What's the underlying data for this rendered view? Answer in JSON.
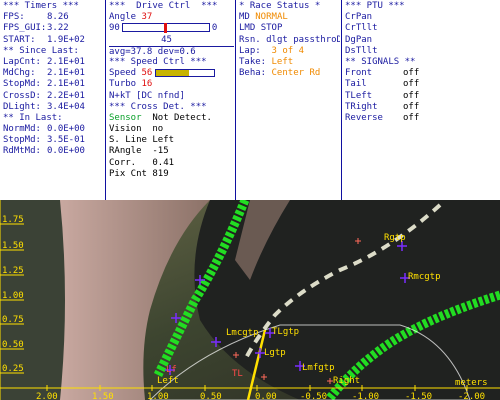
{
  "timers": {
    "header": "*** Timers ***",
    "fps_label": "FPS:",
    "fps": "8.26",
    "fps_gui_label": "FPS_GUI:",
    "fps_gui": "3.22",
    "start_label": "START:",
    "start": "1.9E+02",
    "since_header": "** Since Last:",
    "lapcnt_label": "LapCnt:",
    "lapcnt": "2.1E+01",
    "mdchg_label": "MdChg:",
    "mdchg": "2.1E+01",
    "stopmd_label": "StopMd:",
    "stopmd": "2.1E+01",
    "crossd_label": "CrossD:",
    "crossd": "2.2E+01",
    "dlight_label": "DLight:",
    "dlight": "3.4E+04",
    "inlast_header": "** In Last:",
    "normmd_label": "NormMd:",
    "normmd": "0.0E+00",
    "stopmd2_label": "StopMd:",
    "stopmd2": "3.5E-01",
    "rdmtmd_label": "RdMtMd:",
    "rdmtmd": "0.0E+00"
  },
  "drive": {
    "header": "***  Drive Ctrl  ***",
    "angle_label": "Angle",
    "angle": "37",
    "slider_min": "90",
    "slider_max": "0",
    "slider_value": 45,
    "slider_mid": "45",
    "avg": "avg=37.8",
    "dev": "dev=0.6",
    "speed_header": "*** Speed Ctrl ***",
    "speed_label": "Speed",
    "speed": "56",
    "speed_fraction": 0.56,
    "turbo_label": "Turbo",
    "turbo": "16",
    "nkt": "N+kT [DC nfnd]",
    "cross_header": "*** Cross Det. ***",
    "sensor_label": "Sensor",
    "sensor": "Not Detect.",
    "vision_label": "Vision",
    "vision": "no",
    "sline_label": "S. Line",
    "sline": "Left",
    "rangle_label": "RAngle",
    "rangle": "-15",
    "corr_label": "Corr.",
    "corr": "0.41",
    "pix_label": "Pix Cnt",
    "pix": "819"
  },
  "race": {
    "header": "* Race Status *",
    "md_label": "MD",
    "md": "NORMAL",
    "lmd_label": "LMD",
    "lmd": "STOP",
    "rsn_label": "Rsn.",
    "rsn": "dlgt passthroDgR",
    "lap_label": "Lap:",
    "lap": "3 of 4",
    "take_label": "Take:",
    "take": "Left",
    "beha_label": "Beha:",
    "beha": "Center Rd"
  },
  "ptu": {
    "header": "*** PTU ***",
    "items": [
      "CrPan",
      "CrTllt",
      "DgPan",
      "DsTllt"
    ],
    "signals_header": "** SIGNALS **",
    "signals": [
      {
        "name": "Front",
        "state": "off"
      },
      {
        "name": "Tail",
        "state": "off"
      },
      {
        "name": "TLeft",
        "state": "off"
      },
      {
        "name": "TRight",
        "state": "off"
      },
      {
        "name": "Reverse",
        "state": "off"
      }
    ]
  },
  "camera": {
    "y_ticks": [
      "1.75",
      "1.50",
      "1.25",
      "1.00",
      "0.75",
      "0.50",
      "0.25"
    ],
    "x_ticks": [
      "2.00",
      "1.50",
      "1.00",
      "0.50",
      "0.00",
      "-0.50",
      "-1.00",
      "-1.50",
      "-2.00"
    ],
    "unit": "meters",
    "labels": {
      "rgtp": "Rgtp",
      "rmcgtp": "Rmcgtp",
      "lmcgtp": "Lmcgtp",
      "tlgtp": "TLgtp",
      "lgtp": "Lgtp",
      "lmfgtp": "Lmfgtp",
      "left": "Left",
      "right": "Right",
      "left_small": "Lf",
      "tl_small": "TL"
    },
    "colors": {
      "lane": "#22dd22",
      "marker": "#ffe000",
      "purple": "#7a2cff",
      "axis": "#ffe000"
    }
  }
}
